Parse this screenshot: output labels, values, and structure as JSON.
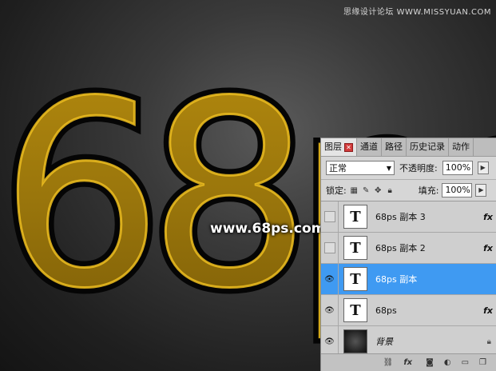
{
  "artwork": {
    "text": "68ps",
    "colors": {
      "gold": "#a0790d",
      "gold_highlight": "#f0c020",
      "stroke": "#050505"
    }
  },
  "watermarks": {
    "top": "思缘设计论坛 WWW.MISSYUAN.COM",
    "center": "www.68ps.com"
  },
  "layers_panel": {
    "tabs": [
      {
        "label": "图层",
        "active": true
      },
      {
        "label": "通道"
      },
      {
        "label": "路径"
      },
      {
        "label": "历史记录"
      },
      {
        "label": "动作"
      }
    ],
    "blend_mode": "正常",
    "opacity_label": "不透明度:",
    "opacity_value": "100%",
    "lock_label": "锁定:",
    "fill_label": "填充:",
    "fill_value": "100%",
    "layers": [
      {
        "name": "68ps 副本 3",
        "visible": false,
        "fx": "fx",
        "type_icon": "T"
      },
      {
        "name": "68ps 副本 2",
        "visible": false,
        "fx": "fx",
        "type_icon": "T"
      },
      {
        "name": "68ps 副本",
        "visible": true,
        "selected": true,
        "type_icon": "T"
      },
      {
        "name": "68ps",
        "visible": true,
        "fx": "fx",
        "type_icon": "T"
      },
      {
        "name": "背景",
        "visible": true,
        "locked": true
      }
    ],
    "bottom_fx": "fx",
    "accent_color": "#3f9af2"
  }
}
